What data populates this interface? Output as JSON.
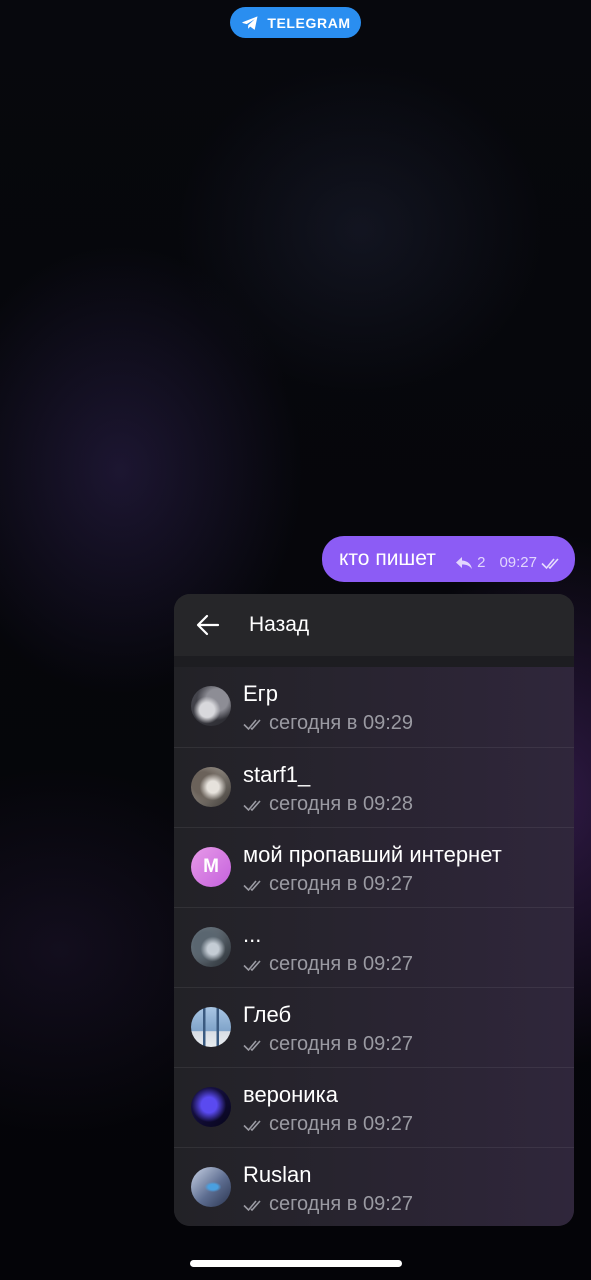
{
  "top_badge": {
    "label": "TELEGRAM",
    "icon": "telegram-plane-icon",
    "color": "#2a8ef0"
  },
  "message": {
    "text": "кто пишет",
    "reply_count": "2",
    "time": "09:27",
    "status_icon": "double-check-icon",
    "bubble_color": "#8c5cf5"
  },
  "panel": {
    "back_label": "Назад",
    "readers": [
      {
        "name": "Егр",
        "status": "сегодня в 09:29",
        "avatar": "photo"
      },
      {
        "name": "starf1_",
        "status": "сегодня в 09:28",
        "avatar": "photo"
      },
      {
        "name": "мой пропавший интернет",
        "status": "сегодня в 09:27",
        "avatar_letter": "M"
      },
      {
        "name": "...",
        "status": "сегодня в 09:27",
        "avatar": "photo"
      },
      {
        "name": "Глеб",
        "status": "сегодня в 09:27",
        "avatar": "photo"
      },
      {
        "name": "вероника",
        "status": "сегодня в 09:27",
        "avatar": "photo"
      },
      {
        "name": "Ruslan",
        "status": "сегодня в 09:27",
        "avatar": "photo"
      }
    ]
  }
}
